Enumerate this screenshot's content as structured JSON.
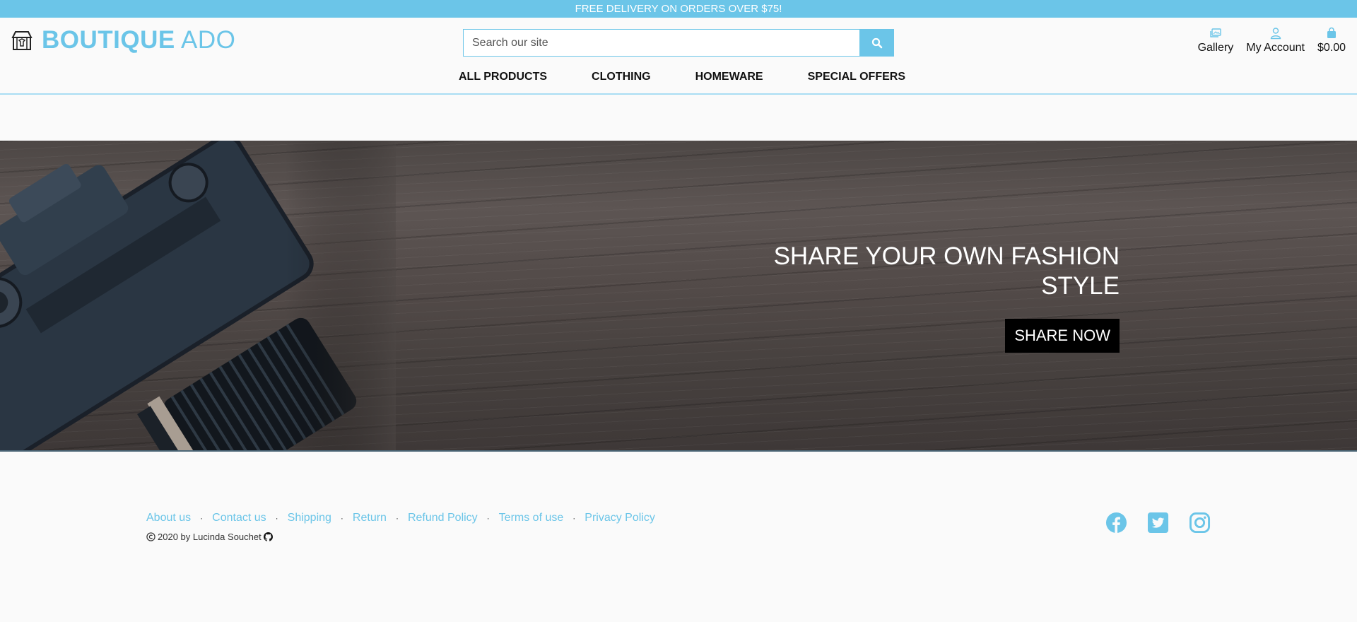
{
  "banner": {
    "text": "FREE DELIVERY ON ORDERS OVER $75!"
  },
  "brand": {
    "bold": "BOUTIQUE",
    "light": "ADO"
  },
  "search": {
    "placeholder": "Search our site"
  },
  "account": {
    "gallery": "Gallery",
    "my_account": "My Account",
    "bag_total": "$0.00"
  },
  "nav": {
    "items": [
      {
        "label": "ALL PRODUCTS"
      },
      {
        "label": "CLOTHING"
      },
      {
        "label": "HOMEWARE"
      },
      {
        "label": "SPECIAL OFFERS"
      }
    ]
  },
  "hero": {
    "headline": "SHARE YOUR OWN FASHION STYLE",
    "button": "SHARE NOW"
  },
  "footer": {
    "links": [
      {
        "label": "About us"
      },
      {
        "label": "Contact us"
      },
      {
        "label": "Shipping"
      },
      {
        "label": "Return"
      },
      {
        "label": "Refund Policy"
      },
      {
        "label": "Terms of use"
      },
      {
        "label": "Privacy Policy"
      }
    ],
    "copyright": "2020 by Lucinda Souchet"
  },
  "icons": {
    "logo": "store-icon",
    "search": "search-icon",
    "gallery": "images-icon",
    "account": "user-icon",
    "bag": "shopping-bag-icon",
    "copyright": "copyright-icon",
    "github": "github-icon",
    "social": [
      "facebook-icon",
      "twitter-icon",
      "instagram-icon"
    ]
  },
  "colors": {
    "accent": "#6bc5e8",
    "hero_button": "#000000"
  }
}
